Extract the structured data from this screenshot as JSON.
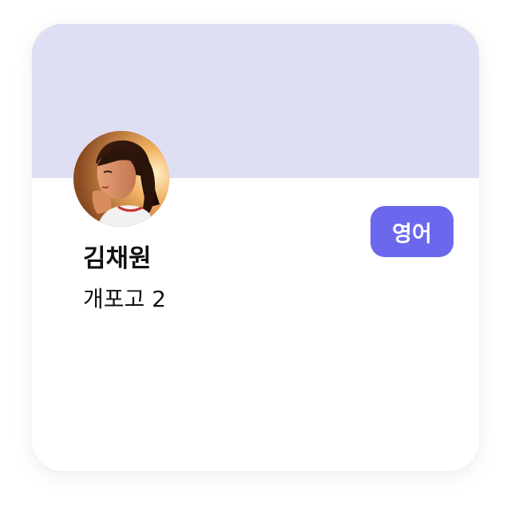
{
  "profile": {
    "name": "김채원",
    "school": "개포고 2",
    "subject_badge": "영어"
  },
  "avatar": {
    "icon": "student-photo"
  },
  "colors": {
    "banner": "#dfdff4",
    "badge": "#6b68ee",
    "card": "#ffffff",
    "text": "#111111"
  }
}
